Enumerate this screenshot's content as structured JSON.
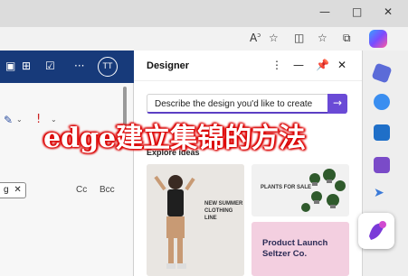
{
  "window": {
    "minimize": "—",
    "maximize": "□",
    "close": "✕"
  },
  "toolbar": {
    "icons": [
      "read-aloud-icon",
      "favorite-icon",
      "split-screen-icon",
      "favorites-icon",
      "collections-icon",
      "more-icon",
      "copilot-icon"
    ]
  },
  "left_app": {
    "ribbon_more": "···",
    "avatar_initials": "TT",
    "chip_label": "g",
    "chip_close": "✕",
    "cc_label": "Cc",
    "bcc_label": "Bcc"
  },
  "designer": {
    "title": "Designer",
    "search_placeholder": "Describe the design you'd like to create",
    "explore_label": "Explore ideas",
    "cards": [
      {
        "line1": "NEW SUMMER",
        "line2": "CLOTHING LINE"
      },
      {
        "line1": "PLANTS FOR SALE"
      },
      {
        "line1": "Product Launch",
        "line2": "Seltzer Co."
      }
    ]
  },
  "overlay_caption": "edge建立集锦的方法",
  "colors": {
    "ribbon": "#173a7a",
    "accent": "#6a4ad6",
    "overlay_glow": "#dd0000"
  }
}
